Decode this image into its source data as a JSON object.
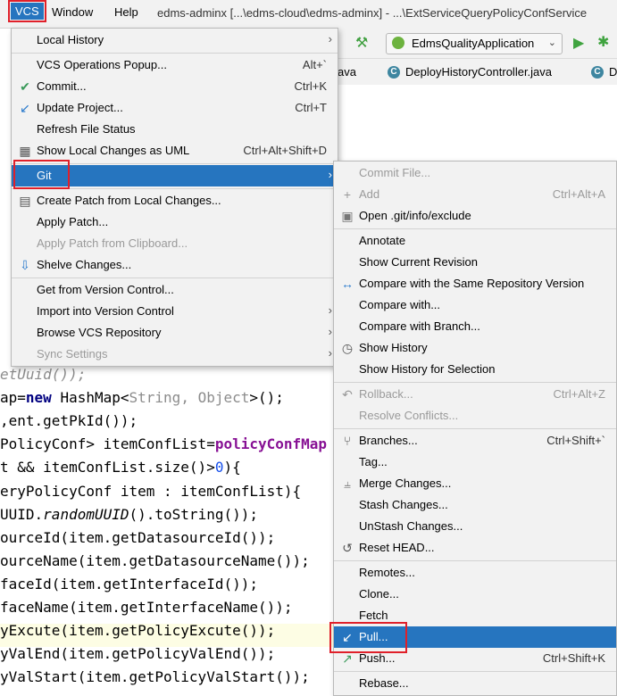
{
  "menubar": {
    "vcs": "VCS",
    "window": "Window",
    "help": "Help",
    "title": "edms-adminx [...\\edms-cloud\\edms-adminx] - ...\\ExtServiceQueryPolicyConfService"
  },
  "toolbar": {
    "run_config": "EdmsQualityApplication"
  },
  "tabs": [
    {
      "label": "ava"
    },
    {
      "label": "DeployHistoryController.java"
    },
    {
      "label": "D"
    }
  ],
  "code_lines": [
    {
      "segments": [
        {
          "t": "etUuid());",
          "c": "gray it"
        }
      ]
    },
    {
      "segments": [
        {
          "t": "ap=",
          "c": ""
        },
        {
          "t": "new",
          "c": "kw"
        },
        {
          "t": " HashMap<",
          "c": ""
        },
        {
          "t": "String, Object",
          "c": "gray"
        },
        {
          "t": ">();",
          "c": ""
        }
      ]
    },
    {
      "segments": [
        {
          "t": ",ent.getPkId());",
          "c": ""
        }
      ]
    },
    {
      "segments": [
        {
          "t": "PolicyConf> itemConfList=",
          "c": ""
        },
        {
          "t": "policyConfMap",
          "c": "purple"
        }
      ]
    },
    {
      "segments": [
        {
          "t": "t && itemConfList.size()>",
          "c": ""
        },
        {
          "t": "0",
          "c": "num"
        },
        {
          "t": "){",
          "c": ""
        }
      ]
    },
    {
      "segments": [
        {
          "t": "eryPolicyConf item : itemConfList){",
          "c": ""
        }
      ]
    },
    {
      "segments": [
        {
          "t": "UUID.",
          "c": ""
        },
        {
          "t": "randomUUID",
          "c": "it"
        },
        {
          "t": "().toString());",
          "c": ""
        }
      ]
    },
    {
      "segments": [
        {
          "t": "ourceId(item.getDatasourceId());",
          "c": ""
        }
      ]
    },
    {
      "segments": [
        {
          "t": "ourceName(item.getDatasourceName());",
          "c": ""
        }
      ]
    },
    {
      "segments": [
        {
          "t": "faceId(item.getInterfaceId());",
          "c": ""
        }
      ]
    },
    {
      "segments": [
        {
          "t": "faceName(item.getInterfaceName());",
          "c": ""
        }
      ]
    },
    {
      "segments": [
        {
          "t": "yExcute(item.getPolicyExcute());",
          "c": ""
        }
      ]
    },
    {
      "segments": [
        {
          "t": "yValEnd(item.getPolicyValEnd());",
          "c": ""
        }
      ]
    },
    {
      "segments": [
        {
          "t": "yValStart(item.getPolicyValStart());",
          "c": ""
        }
      ]
    }
  ],
  "vcs_menu": {
    "items": [
      {
        "label": "Local History",
        "shortcut": "",
        "arrow": true,
        "icon": "",
        "disabled": false,
        "selected": false
      },
      {
        "sep": true
      },
      {
        "label": "VCS Operations Popup...",
        "shortcut": "Alt+`",
        "arrow": false,
        "icon": "",
        "disabled": false,
        "selected": false
      },
      {
        "label": "Commit...",
        "shortcut": "Ctrl+K",
        "arrow": false,
        "icon": "check-icon",
        "disabled": false,
        "selected": false
      },
      {
        "label": "Update Project...",
        "shortcut": "Ctrl+T",
        "arrow": false,
        "icon": "update-arrow-icon",
        "disabled": false,
        "selected": false
      },
      {
        "label": "Refresh File Status",
        "shortcut": "",
        "arrow": false,
        "icon": "",
        "disabled": false,
        "selected": false
      },
      {
        "label": "Show Local Changes as UML",
        "shortcut": "Ctrl+Alt+Shift+D",
        "arrow": false,
        "icon": "uml-diagram-icon",
        "disabled": false,
        "selected": false
      },
      {
        "sep": true
      },
      {
        "label": "Git",
        "shortcut": "",
        "arrow": true,
        "icon": "",
        "disabled": false,
        "selected": true
      },
      {
        "sep": true
      },
      {
        "label": "Create Patch from Local Changes...",
        "shortcut": "",
        "arrow": false,
        "icon": "patch-icon",
        "disabled": false,
        "selected": false
      },
      {
        "label": "Apply Patch...",
        "shortcut": "",
        "arrow": false,
        "icon": "",
        "disabled": false,
        "selected": false
      },
      {
        "label": "Apply Patch from Clipboard...",
        "shortcut": "",
        "arrow": false,
        "icon": "",
        "disabled": true,
        "selected": false
      },
      {
        "label": "Shelve Changes...",
        "shortcut": "",
        "arrow": false,
        "icon": "shelve-icon",
        "disabled": false,
        "selected": false
      },
      {
        "sep": true
      },
      {
        "label": "Get from Version Control...",
        "shortcut": "",
        "arrow": false,
        "icon": "",
        "disabled": false,
        "selected": false
      },
      {
        "label": "Import into Version Control",
        "shortcut": "",
        "arrow": true,
        "icon": "",
        "disabled": false,
        "selected": false
      },
      {
        "label": "Browse VCS Repository",
        "shortcut": "",
        "arrow": true,
        "icon": "",
        "disabled": false,
        "selected": false
      },
      {
        "label": "Sync Settings",
        "shortcut": "",
        "arrow": true,
        "icon": "",
        "disabled": true,
        "selected": false
      }
    ]
  },
  "git_menu": {
    "items": [
      {
        "label": "Commit File...",
        "shortcut": "",
        "icon": "",
        "disabled": true,
        "selected": false
      },
      {
        "label": "Add",
        "shortcut": "Ctrl+Alt+A",
        "icon": "plus-icon",
        "disabled": true,
        "selected": false
      },
      {
        "label": "Open .git/info/exclude",
        "shortcut": "",
        "icon": "file-icon",
        "disabled": false,
        "selected": false
      },
      {
        "sep": true
      },
      {
        "label": "Annotate",
        "shortcut": "",
        "icon": "",
        "disabled": false,
        "selected": false
      },
      {
        "label": "Show Current Revision",
        "shortcut": "",
        "icon": "",
        "disabled": false,
        "selected": false
      },
      {
        "label": "Compare with the Same Repository Version",
        "shortcut": "",
        "icon": "compare-arrows-icon",
        "disabled": false,
        "selected": false
      },
      {
        "label": "Compare with...",
        "shortcut": "",
        "icon": "",
        "disabled": false,
        "selected": false
      },
      {
        "label": "Compare with Branch...",
        "shortcut": "",
        "icon": "",
        "disabled": false,
        "selected": false
      },
      {
        "label": "Show History",
        "shortcut": "",
        "icon": "clock-icon",
        "disabled": false,
        "selected": false
      },
      {
        "label": "Show History for Selection",
        "shortcut": "",
        "icon": "",
        "disabled": false,
        "selected": false
      },
      {
        "sep": true
      },
      {
        "label": "Rollback...",
        "shortcut": "Ctrl+Alt+Z",
        "icon": "rollback-icon",
        "disabled": true,
        "selected": false
      },
      {
        "label": "Resolve Conflicts...",
        "shortcut": "",
        "icon": "",
        "disabled": true,
        "selected": false
      },
      {
        "sep": true
      },
      {
        "label": "Branches...",
        "shortcut": "Ctrl+Shift+`",
        "icon": "branch-icon",
        "disabled": false,
        "selected": false
      },
      {
        "label": "Tag...",
        "shortcut": "",
        "icon": "",
        "disabled": false,
        "selected": false
      },
      {
        "label": "Merge Changes...",
        "shortcut": "",
        "icon": "merge-icon",
        "disabled": false,
        "selected": false
      },
      {
        "label": "Stash Changes...",
        "shortcut": "",
        "icon": "",
        "disabled": false,
        "selected": false
      },
      {
        "label": "UnStash Changes...",
        "shortcut": "",
        "icon": "",
        "disabled": false,
        "selected": false
      },
      {
        "label": "Reset HEAD...",
        "shortcut": "",
        "icon": "reset-icon",
        "disabled": false,
        "selected": false
      },
      {
        "sep": true
      },
      {
        "label": "Remotes...",
        "shortcut": "",
        "icon": "",
        "disabled": false,
        "selected": false
      },
      {
        "label": "Clone...",
        "shortcut": "",
        "icon": "",
        "disabled": false,
        "selected": false
      },
      {
        "label": "Fetch",
        "shortcut": "",
        "icon": "",
        "disabled": false,
        "selected": false
      },
      {
        "label": "Pull...",
        "shortcut": "",
        "icon": "pull-arrow-icon",
        "disabled": false,
        "selected": true
      },
      {
        "label": "Push...",
        "shortcut": "Ctrl+Shift+K",
        "icon": "push-arrow-icon",
        "disabled": false,
        "selected": false
      },
      {
        "sep": true
      },
      {
        "label": "Rebase...",
        "shortcut": "",
        "icon": "",
        "disabled": false,
        "selected": false
      }
    ]
  }
}
